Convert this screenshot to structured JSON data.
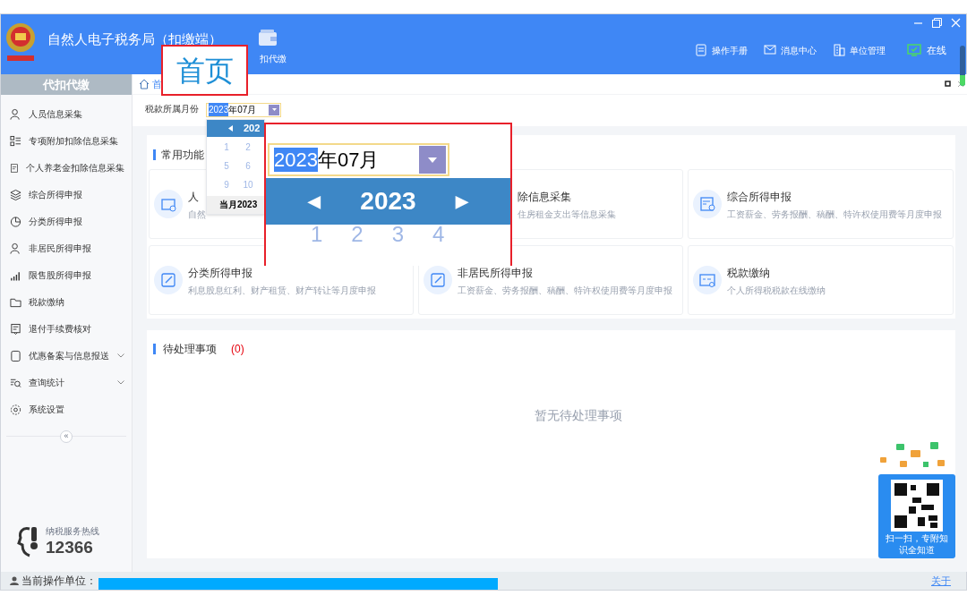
{
  "window": {
    "title": "自然人电子税务局（扣缴端）"
  },
  "nav": {
    "label": "扣代缴"
  },
  "header_links": [
    {
      "label": "操作手册"
    },
    {
      "label": "消息中心"
    },
    {
      "label": "单位管理"
    }
  ],
  "connection": {
    "label": "在线",
    "online": true
  },
  "sidebar": {
    "title": "代扣代缴",
    "items": [
      {
        "label": "人员信息采集",
        "has_submenu": false
      },
      {
        "label": "专项附加扣除信息采集",
        "has_submenu": false
      },
      {
        "label": "个人养老金扣除信息采集",
        "has_submenu": false
      },
      {
        "label": "综合所得申报",
        "has_submenu": false
      },
      {
        "label": "分类所得申报",
        "has_submenu": false
      },
      {
        "label": "非居民所得申报",
        "has_submenu": false
      },
      {
        "label": "限售股所得申报",
        "has_submenu": false
      },
      {
        "label": "税款缴纳",
        "has_submenu": false
      },
      {
        "label": "退付手续费核对",
        "has_submenu": false
      },
      {
        "label": "优惠备案与信息报送",
        "has_submenu": true
      },
      {
        "label": "查询统计",
        "has_submenu": true
      },
      {
        "label": "系统设置",
        "has_submenu": false
      }
    ],
    "collapse": "«",
    "hotline_label": "纳税服务热线",
    "hotline": "12366"
  },
  "tab": {
    "label": "首"
  },
  "month_filter": {
    "label": "税款所属月份",
    "selected_part": "2023",
    "rest": "年07月"
  },
  "month_popup": {
    "year": "202",
    "months": [
      "1",
      "2",
      "5",
      "6",
      "9",
      "10"
    ],
    "footer": "当月2023"
  },
  "common_functions": {
    "title": "常用功能",
    "cards": [
      {
        "title": "人",
        "description": "自然",
        "icon_visible": true
      },
      {
        "title": "除信息采集",
        "description": "住房租金支出等信息采集",
        "icon_visible": false
      },
      {
        "title": "综合所得申报",
        "description": "工资薪金、劳务报酬、稿酬、特许权使用费等月度申报",
        "icon_visible": true
      },
      {
        "title": "分类所得申报",
        "description": "利息股息红利、财产租赁、财产转让等月度申报",
        "icon_visible": true
      },
      {
        "title": "非居民所得申报",
        "description": "工资薪金、劳务报酬、稿酬、特许权使用费等月度申报",
        "icon_visible": true
      },
      {
        "title": "税款缴纳",
        "description": "个人所得税税款在线缴纳",
        "icon_visible": true
      }
    ]
  },
  "pending": {
    "title": "待处理事项",
    "count": "(0)",
    "empty_text": "暂无待处理事项"
  },
  "qr_widget": {
    "caption": "扫一扫，专附知识全知道"
  },
  "status_bar": {
    "label": "当前操作单位：",
    "about": "关于"
  },
  "title_callout": {
    "text": "首页"
  },
  "date_callout": {
    "selected_part": "2023",
    "rest": "年07月",
    "prev": "◀",
    "year": "2023",
    "next": "▶",
    "months": [
      "1",
      "2",
      "3",
      "4"
    ]
  }
}
